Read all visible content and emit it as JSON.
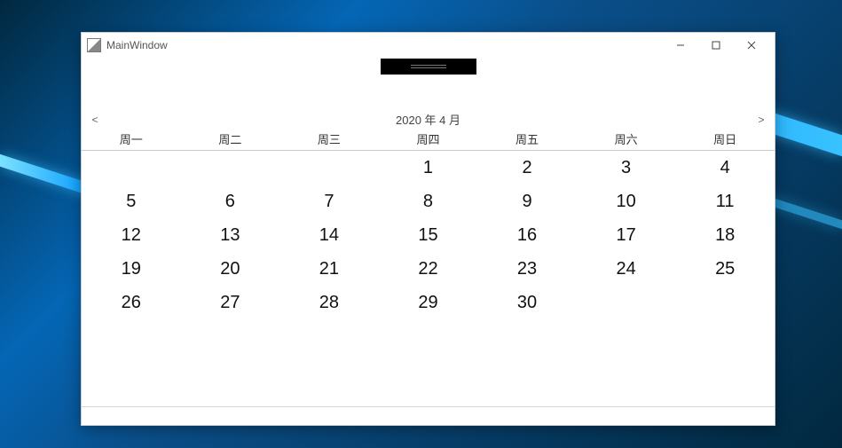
{
  "window": {
    "title": "MainWindow"
  },
  "nav": {
    "prev": "<",
    "next": ">"
  },
  "calendar": {
    "month_label": "2020 年 4 月",
    "weekdays": [
      "周一",
      "周二",
      "周三",
      "周四",
      "周五",
      "周六",
      "周日"
    ],
    "weeks": [
      [
        "",
        "",
        "",
        "1",
        "2",
        "3",
        "4"
      ],
      [
        "5",
        "6",
        "7",
        "8",
        "9",
        "10",
        "11"
      ],
      [
        "12",
        "13",
        "14",
        "15",
        "16",
        "17",
        "18"
      ],
      [
        "19",
        "20",
        "21",
        "22",
        "23",
        "24",
        "25"
      ],
      [
        "26",
        "27",
        "28",
        "29",
        "30",
        "",
        ""
      ]
    ]
  }
}
